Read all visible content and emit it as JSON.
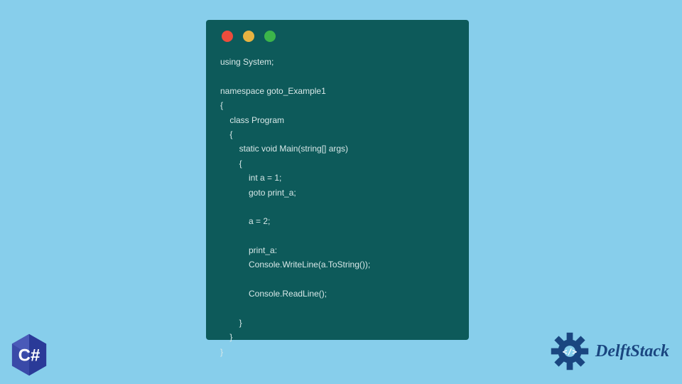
{
  "window": {
    "dots": {
      "red": "#ed4c3c",
      "yellow": "#e8b341",
      "green": "#3cb54a"
    }
  },
  "code": {
    "line1": "using System;",
    "line2": "",
    "line3": "namespace goto_Example1",
    "line4": "{",
    "line5": "    class Program",
    "line6": "    {",
    "line7": "        static void Main(string[] args)",
    "line8": "        {",
    "line9": "            int a = 1;",
    "line10": "            goto print_a;",
    "line11": "",
    "line12": "            a = 2;",
    "line13": "",
    "line14": "            print_a:",
    "line15": "            Console.WriteLine(a.ToString());",
    "line16": "",
    "line17": "            Console.ReadLine();",
    "line18": "",
    "line19": "        }",
    "line20": "    }",
    "line21": "}"
  },
  "branding": {
    "delftstack": "DelftStack",
    "csharp": "C#"
  }
}
